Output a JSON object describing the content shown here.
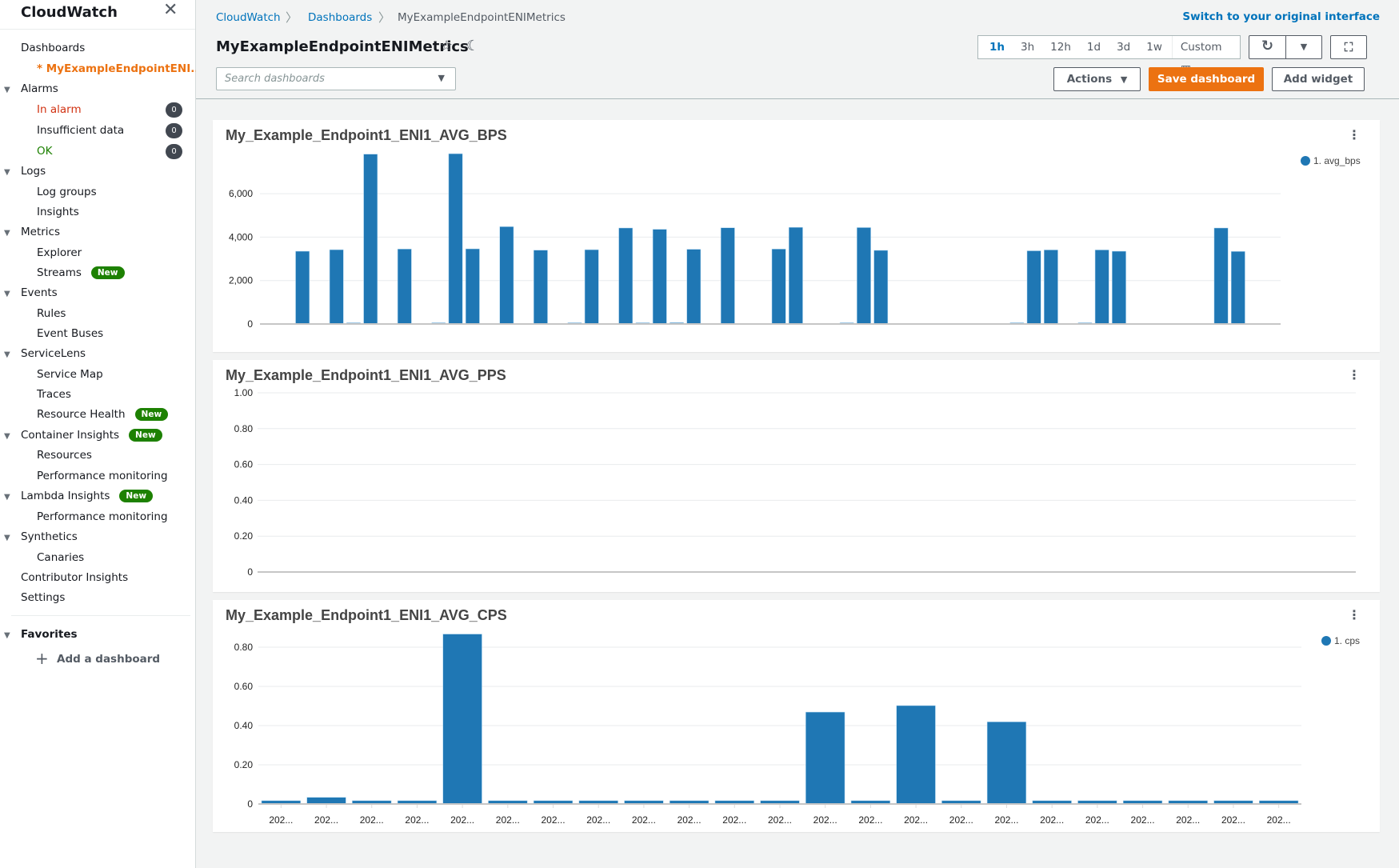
{
  "sidebar": {
    "title": "CloudWatch",
    "items": [
      {
        "label": "Dashboards",
        "level": 1,
        "y": 52
      },
      {
        "label": "* MyExampleEndpointENI...",
        "level": 2,
        "y": 78,
        "color": "#ec7211",
        "bold": true
      },
      {
        "label": "Alarms",
        "level": 1,
        "y": 103,
        "caret": true
      },
      {
        "label": "In alarm",
        "level": 2,
        "y": 129,
        "color": "#d13212",
        "count": "0"
      },
      {
        "label": "Insufficient data",
        "level": 2,
        "y": 155,
        "count": "0"
      },
      {
        "label": "OK",
        "level": 2,
        "y": 181,
        "color": "#1d8102",
        "count": "0"
      },
      {
        "label": "Logs",
        "level": 1,
        "y": 206,
        "caret": true
      },
      {
        "label": "Log groups",
        "level": 2,
        "y": 232
      },
      {
        "label": "Insights",
        "level": 2,
        "y": 257
      },
      {
        "label": "Metrics",
        "level": 1,
        "y": 282,
        "caret": true
      },
      {
        "label": "Explorer",
        "level": 2,
        "y": 308
      },
      {
        "label": "Streams",
        "level": 2,
        "y": 333,
        "badge": "New"
      },
      {
        "label": "Events",
        "level": 1,
        "y": 358,
        "caret": true
      },
      {
        "label": "Rules",
        "level": 2,
        "y": 384
      },
      {
        "label": "Event Buses",
        "level": 2,
        "y": 409
      },
      {
        "label": "ServiceLens",
        "level": 1,
        "y": 434,
        "caret": true
      },
      {
        "label": "Service Map",
        "level": 2,
        "y": 460
      },
      {
        "label": "Traces",
        "level": 2,
        "y": 485
      },
      {
        "label": "Resource Health",
        "level": 2,
        "y": 510,
        "badge": "New"
      },
      {
        "label": "Container Insights",
        "level": 1,
        "y": 536,
        "caret": true,
        "badge": "New"
      },
      {
        "label": "Resources",
        "level": 2,
        "y": 561
      },
      {
        "label": "Performance monitoring",
        "level": 2,
        "y": 587
      },
      {
        "label": "Lambda Insights",
        "level": 1,
        "y": 612,
        "caret": true,
        "badge": "New"
      },
      {
        "label": "Performance monitoring",
        "level": 2,
        "y": 638
      },
      {
        "label": "Synthetics",
        "level": 1,
        "y": 663,
        "caret": true
      },
      {
        "label": "Canaries",
        "level": 2,
        "y": 689
      },
      {
        "label": "Contributor Insights",
        "level": 1,
        "y": 714
      },
      {
        "label": "Settings",
        "level": 1,
        "y": 739
      }
    ],
    "favorites_label": "Favorites",
    "add_dashboard_label": "Add a dashboard"
  },
  "header": {
    "breadcrumbs": [
      "CloudWatch",
      "Dashboards",
      "MyExampleEndpointENIMetrics"
    ],
    "switch_link": "Switch to your original interface",
    "title": "MyExampleEndpointENIMetrics",
    "search_placeholder": "Search dashboards",
    "search_value": "",
    "time_ranges": [
      "1h",
      "3h",
      "12h",
      "1d",
      "3d",
      "1w"
    ],
    "time_active": "1h",
    "custom_label": "Custom",
    "actions_label": "Actions",
    "save_label": "Save dashboard",
    "add_widget_label": "Add widget"
  },
  "colors": {
    "series": "#1f77b4",
    "accent": "#ec7211",
    "link": "#0073bb"
  },
  "chart_data": [
    {
      "type": "bar",
      "title": "My_Example_Endpoint1_ENI1_AVG_BPS",
      "legend": [
        "1. avg_bps"
      ],
      "legend_position": "top-right",
      "ylim": [
        0,
        8000
      ],
      "yticks": [
        0,
        2000,
        4000,
        6000
      ],
      "ytick_labels": [
        "0",
        "2,000",
        "4,000",
        "6,000"
      ],
      "grid": true,
      "series": [
        {
          "name": "1. avg_bps",
          "values": [
            null,
            null,
            3350,
            null,
            3420,
            30,
            7820,
            null,
            3450,
            null,
            30,
            7840,
            3460,
            null,
            4480,
            null,
            3400,
            null,
            30,
            3420,
            null,
            4420,
            30,
            4360,
            60,
            3440,
            null,
            4430,
            null,
            null,
            3450,
            4450,
            null,
            null,
            30,
            4440,
            3390,
            null,
            null,
            null,
            null,
            null,
            null,
            null,
            30,
            3370,
            3410,
            null,
            30,
            3410,
            3350,
            null,
            null,
            null,
            null,
            null,
            4420,
            3340,
            null,
            null
          ]
        }
      ]
    },
    {
      "type": "bar",
      "title": "My_Example_Endpoint1_ENI1_AVG_PPS",
      "legend": [],
      "ylim": [
        0,
        1.0
      ],
      "yticks": [
        0,
        0.2,
        0.4,
        0.6,
        0.8,
        1.0
      ],
      "ytick_labels": [
        "0",
        "0.20",
        "0.40",
        "0.60",
        "0.80",
        "1.00"
      ],
      "grid": true,
      "series": []
    },
    {
      "type": "bar",
      "title": "My_Example_Endpoint1_ENI1_AVG_CPS",
      "legend": [
        "1. cps"
      ],
      "legend_position": "top-right",
      "ylim": [
        0,
        0.88
      ],
      "yticks": [
        0,
        0.2,
        0.4,
        0.6,
        0.8
      ],
      "ytick_labels": [
        "0",
        "0.20",
        "0.40",
        "0.60",
        "0.80"
      ],
      "grid": true,
      "categories": [
        "202...",
        "202...",
        "202...",
        "202...",
        "202...",
        "202...",
        "202...",
        "202...",
        "202...",
        "202...",
        "202...",
        "202...",
        "202...",
        "202...",
        "202...",
        "202...",
        "202...",
        "202...",
        "202...",
        "202...",
        "202...",
        "202...",
        "202..."
      ],
      "series": [
        {
          "name": "1. cps",
          "values": [
            0.017,
            0.034,
            0.017,
            0.017,
            0.867,
            0.017,
            0.017,
            0.017,
            0.017,
            0.017,
            0.017,
            0.017,
            0.469,
            0.017,
            0.502,
            0.017,
            0.419,
            0.017,
            0.017,
            0.017,
            0.017,
            0.017,
            0.017
          ]
        }
      ]
    }
  ]
}
